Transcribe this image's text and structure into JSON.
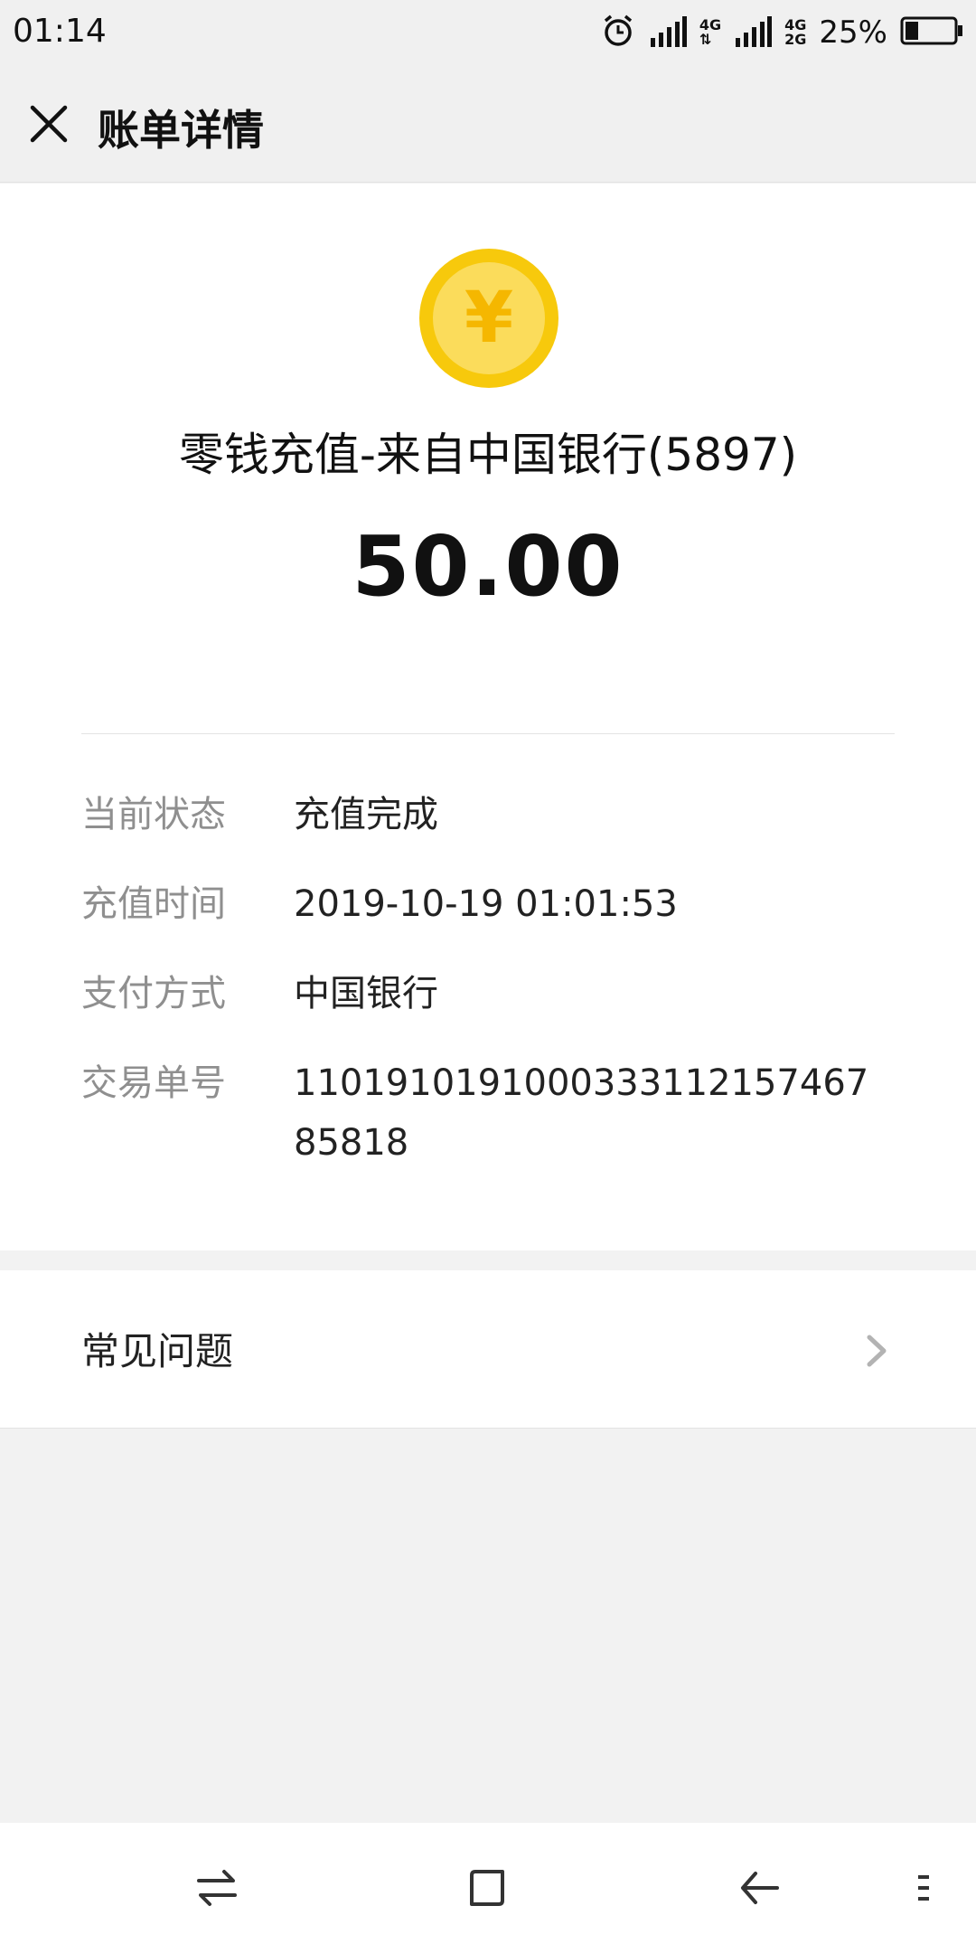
{
  "status_bar": {
    "time": "01:14",
    "network_top": "4G",
    "network_mid": "4G",
    "network_bottom": "2G",
    "battery": "25%",
    "icons": [
      "alarm-icon",
      "signal-icon",
      "data-arrows-icon",
      "signal-icon",
      "battery-icon"
    ]
  },
  "header": {
    "title": "账单详情",
    "close_icon": "close-icon"
  },
  "transaction": {
    "icon": "yuan-coin-icon",
    "coin_symbol": "¥",
    "merchant": "零钱充值-来自中国银行(5897)",
    "amount": "50.00"
  },
  "details": [
    {
      "label": "当前状态",
      "value": "充值完成"
    },
    {
      "label": "充值时间",
      "value": "2019-10-19 01:01:53"
    },
    {
      "label": "支付方式",
      "value": "中国银行"
    },
    {
      "label": "交易单号",
      "value": "110191019100033311215746785818"
    }
  ],
  "faq": {
    "label": "常见问题",
    "icon": "chevron-right-icon"
  },
  "nav_bar": {
    "icons": [
      "switch-icon",
      "home-square-icon",
      "back-icon",
      "menu-icon"
    ]
  },
  "colors": {
    "coin_outer": "#f7c90c",
    "coin_inner": "#fbdc5b",
    "label_gray": "#8f8f8f",
    "background": "#f2f2f2"
  }
}
